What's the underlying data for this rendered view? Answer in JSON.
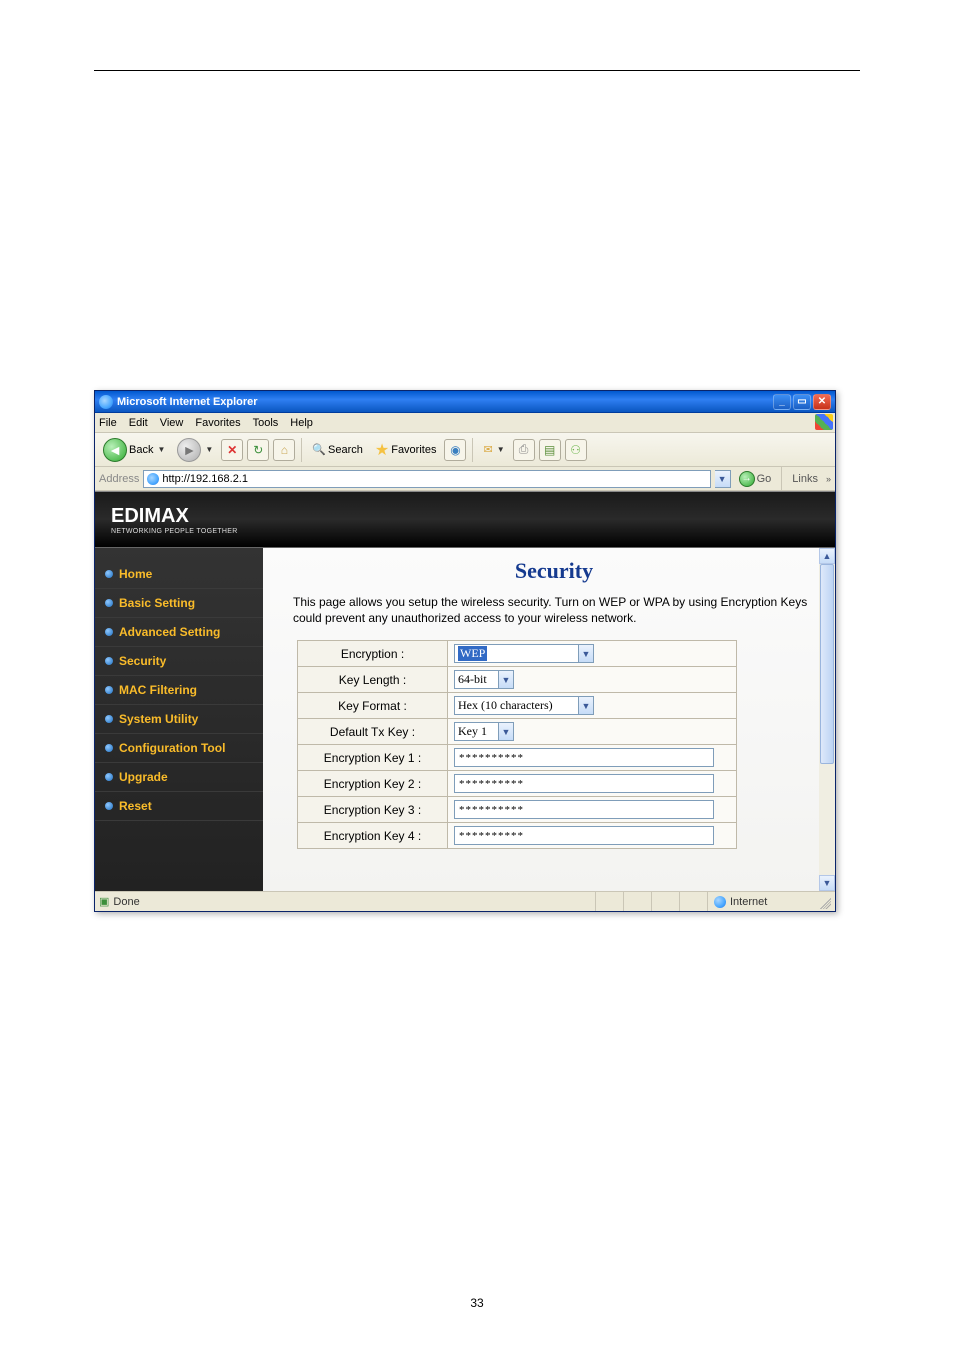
{
  "window": {
    "title": "Microsoft Internet Explorer"
  },
  "menu": {
    "items": [
      "File",
      "Edit",
      "View",
      "Favorites",
      "Tools",
      "Help"
    ]
  },
  "toolbar": {
    "back": "Back",
    "search": "Search",
    "favorites": "Favorites"
  },
  "address": {
    "label": "Address",
    "url": "http://192.168.2.1",
    "go": "Go",
    "links": "Links"
  },
  "brand": {
    "name": "EDIMAX",
    "tagline": "NETWORKING PEOPLE TOGETHER"
  },
  "sidebar": {
    "items": [
      {
        "label": "Home"
      },
      {
        "label": "Basic Setting"
      },
      {
        "label": "Advanced Setting"
      },
      {
        "label": "Security"
      },
      {
        "label": "MAC Filtering"
      },
      {
        "label": "System Utility"
      },
      {
        "label": "Configuration Tool"
      },
      {
        "label": "Upgrade"
      },
      {
        "label": "Reset"
      }
    ]
  },
  "page": {
    "title": "Security",
    "desc": "This page allows you setup the wireless security. Turn on WEP or WPA by using Encryption Keys could prevent any unauthorized access to your wireless network.",
    "rows": {
      "encryption": {
        "label": "Encryption :",
        "value": "WEP"
      },
      "key_length": {
        "label": "Key Length :",
        "value": "64-bit"
      },
      "key_format": {
        "label": "Key Format :",
        "value": "Hex (10 characters)"
      },
      "default_tx": {
        "label": "Default Tx Key :",
        "value": "Key 1"
      },
      "enc1": {
        "label": "Encryption Key 1 :",
        "value": "**********"
      },
      "enc2": {
        "label": "Encryption Key 2 :",
        "value": "**********"
      },
      "enc3": {
        "label": "Encryption Key 3 :",
        "value": "**********"
      },
      "enc4": {
        "label": "Encryption Key 4 :",
        "value": "**********"
      }
    }
  },
  "status": {
    "done": "Done",
    "zone": "Internet"
  },
  "doc": {
    "page_number": "33"
  }
}
